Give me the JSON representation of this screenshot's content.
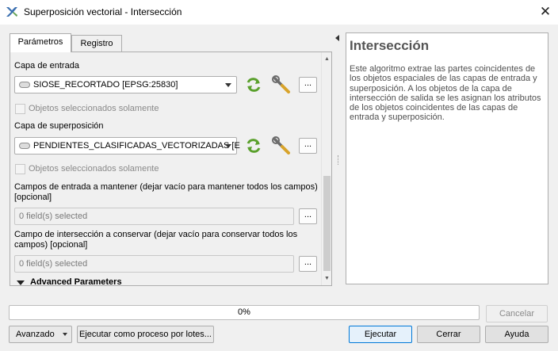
{
  "window": {
    "title": "Superposición vectorial - Intersección",
    "close_glyph": "✕"
  },
  "tabs": [
    {
      "label": "Parámetros",
      "active": true
    },
    {
      "label": "Registro",
      "active": false
    }
  ],
  "params": {
    "input_layer_label": "Capa de entrada",
    "input_layer_value": "SIOSE_RECORTADO [EPSG:25830]",
    "input_selected_only": "Objetos seleccionados solamente",
    "overlay_layer_label": "Capa de superposición",
    "overlay_layer_value": "PENDIENTES_CLASIFICADAS_VECTORIZADAS [E",
    "overlay_selected_only": "Objetos seleccionados solamente",
    "input_fields_label_1": "Campos de entrada a mantener (dejar vacío para mantener todos los campos)",
    "input_fields_label_2": "[opcional]",
    "input_fields_value": "0 field(s) selected",
    "overlay_fields_label_1": "Campo de intersección a conservar (dejar vacío para conservar todos los",
    "overlay_fields_label_2": "campos) [opcional]",
    "overlay_fields_value": "0 field(s) selected",
    "advanced_header": "Advanced Parameters",
    "dots": "..."
  },
  "help": {
    "title": "Intersección",
    "body": "Este algoritmo extrae las partes coincidentes de los objetos espaciales de las capas de entrada y superposición. A los objetos de la capa de intersección de salida se les asignan los atributos de los objetos coincidentes de las capas de entrada y superposición."
  },
  "progress": {
    "value": 0,
    "text": "0%"
  },
  "buttons": {
    "cancel": "Cancelar",
    "advanced": "Avanzado",
    "batch": "Ejecutar como proceso por lotes...",
    "run": "Ejecutar",
    "close": "Cerrar",
    "help": "Ayuda"
  },
  "icons": {
    "app": "qgis-logo-icon",
    "iterate": "iterate-icon",
    "settings": "wrench-icon",
    "accent_green": "#5aa02c"
  }
}
